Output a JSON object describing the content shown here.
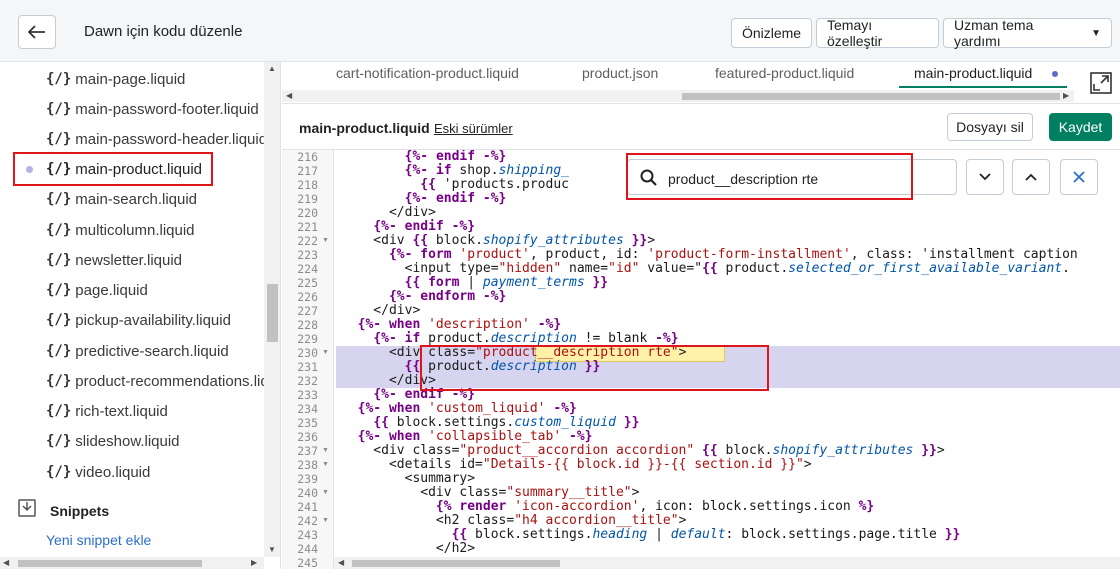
{
  "header": {
    "title": "Dawn için kodu düzenle",
    "preview_label": "Önizleme",
    "customize_label": "Temayı özelleştir",
    "expert_help_label": "Uzman tema yardımı"
  },
  "sidebar": {
    "files": [
      {
        "icon": "{/}",
        "label": "main-page.liquid"
      },
      {
        "icon": "{/}",
        "label": "main-password-footer.liquid"
      },
      {
        "icon": "{/}",
        "label": "main-password-header.liquid"
      },
      {
        "icon": "{/}",
        "label": "main-product.liquid",
        "active": true
      },
      {
        "icon": "{/}",
        "label": "main-search.liquid"
      },
      {
        "icon": "{/}",
        "label": "multicolumn.liquid"
      },
      {
        "icon": "{/}",
        "label": "newsletter.liquid"
      },
      {
        "icon": "{/}",
        "label": "page.liquid"
      },
      {
        "icon": "{/}",
        "label": "pickup-availability.liquid"
      },
      {
        "icon": "{/}",
        "label": "predictive-search.liquid"
      },
      {
        "icon": "{/}",
        "label": "product-recommendations.liquid"
      },
      {
        "icon": "{/}",
        "label": "rich-text.liquid"
      },
      {
        "icon": "{/}",
        "label": "slideshow.liquid"
      },
      {
        "icon": "{/}",
        "label": "video.liquid"
      }
    ],
    "snippets_heading": "Snippets",
    "add_snippet_label": "Yeni snippet ekle"
  },
  "tabs": [
    {
      "label": "cart-notification-product.liquid"
    },
    {
      "label": "product.json"
    },
    {
      "label": "featured-product.liquid"
    },
    {
      "label": "main-product.liquid",
      "active": true
    }
  ],
  "editor": {
    "file_name": "main-product.liquid",
    "old_versions_label": "Eski sürümler",
    "delete_label": "Dosyayı sil",
    "save_label": "Kaydet"
  },
  "search": {
    "value": "product__description rte"
  },
  "code": {
    "line_numbers": [
      "216",
      "217",
      "218",
      "219",
      "220",
      "221",
      "222",
      "223",
      "224",
      "225",
      "226",
      "227",
      "228",
      "229",
      "230",
      "231",
      "232",
      "233",
      "234",
      "235",
      "236",
      "237",
      "238",
      "239",
      "240",
      "241",
      "242",
      "243",
      "244",
      "245"
    ],
    "fold_lines": [
      "222",
      "230",
      "237",
      "238",
      "240",
      "242"
    ],
    "highlighted_lines": [
      "230",
      "231",
      "232"
    ],
    "lines": [
      "        {%- endif -%}",
      "        {%- if shop.shipping_",
      "          {{ 'products.produc",
      "        {%- endif -%}",
      "      </div>",
      "    {%- endif -%}",
      "    <div {{ block.shopify_attributes }}>",
      "      {%- form 'product', product, id: 'product-form-installment', class: 'installment caption",
      "        <input type=\"hidden\" name=\"id\" value=\"{{ product.selected_or_first_available_variant.",
      "        {{ form | payment_terms }}",
      "      {%- endform -%}",
      "    </div>",
      "  {%- when 'description' -%}",
      "    {%- if product.description != blank -%}",
      "      <div class=\"product__description rte\">",
      "        {{ product.description }}",
      "      </div>",
      "    {%- endif -%}",
      "  {%- when 'custom_liquid' -%}",
      "    {{ block.settings.custom_liquid }}",
      "  {%- when 'collapsible_tab' -%}",
      "    <div class=\"product__accordion accordion\" {{ block.shopify_attributes }}>",
      "      <details id=\"Details-{{ block.id }}-{{ section.id }}\">",
      "        <summary>",
      "          <div class=\"summary__title\">",
      "            {% render 'icon-accordion', icon: block.settings.icon %}",
      "            <h2 class=\"h4 accordion__title\">",
      "              {{ block.settings.heading | default: block.settings.page.title }}",
      "            </h2>",
      ""
    ]
  },
  "colors": {
    "accent": "#008060",
    "annotation_red": "#e0151b",
    "line_highlight": "#d7d4f0",
    "active_dot": "#5c6ac4"
  }
}
